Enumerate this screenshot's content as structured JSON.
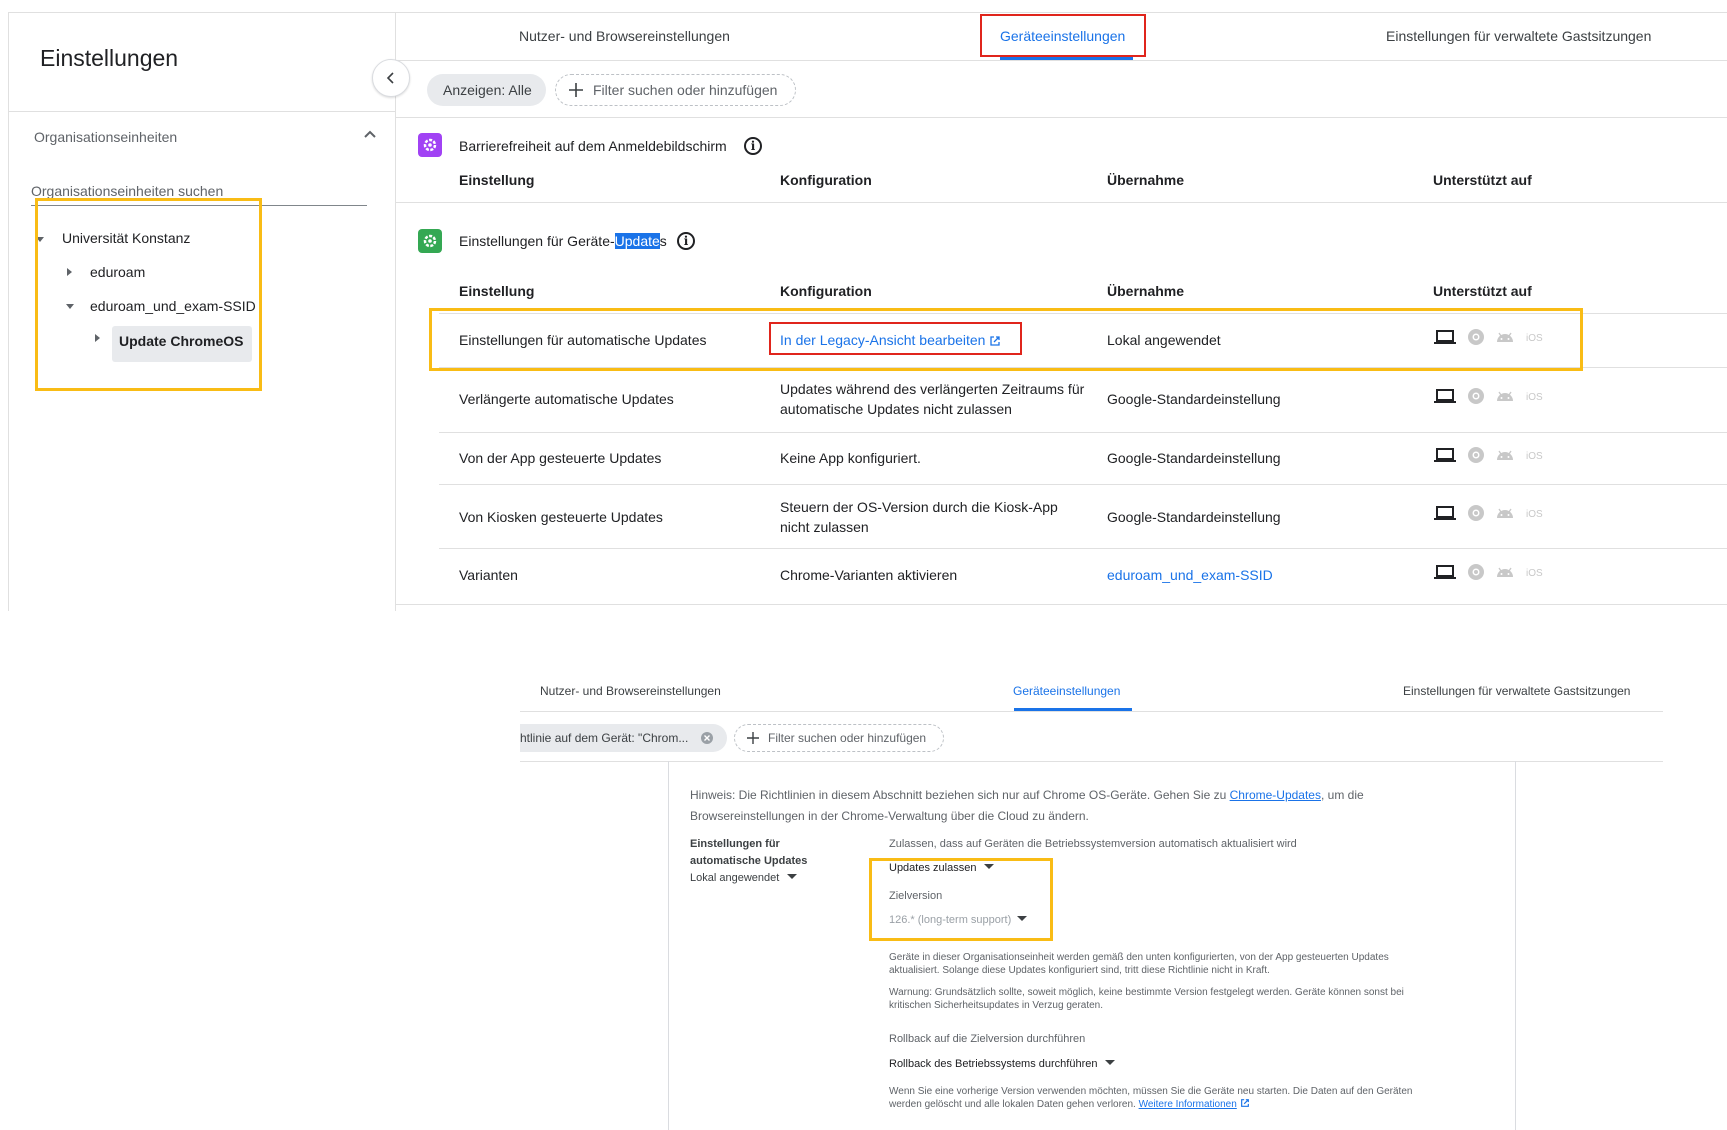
{
  "top": {
    "sidebar": {
      "title": "Einstellungen",
      "ou_header": "Organisationseinheiten",
      "ou_search_placeholder": "Organisationseinheiten suchen",
      "tree": [
        {
          "label": "Universität Konstanz"
        },
        {
          "label": "eduroam"
        },
        {
          "label": "eduroam_und_exam-SSID"
        },
        {
          "label": "Update ChromeOS"
        }
      ]
    },
    "tabs": [
      "Nutzer- und Browsereinstellungen",
      "Geräteeinstellungen",
      "Einstellungen für verwaltete Gastsitzungen"
    ],
    "chip_show": "Anzeigen: Alle",
    "chip_filter": "Filter suchen oder hinzufügen",
    "section1": {
      "title": "Barrierefreiheit auf dem Anmeldebildschirm"
    },
    "section2": {
      "title_before": "Einstellungen für Geräte-",
      "title_highlight": "Update",
      "title_after": "s"
    },
    "columns": [
      "Einstellung",
      "Konfiguration",
      "Übernahme",
      "Unterstützt auf"
    ],
    "rows": [
      {
        "setting": "Einstellungen für automatische Updates",
        "config": "In der Legacy-Ansicht bearbeiten",
        "inherit": "Lokal angewendet"
      },
      {
        "setting": "Verlängerte automatische Updates",
        "config": "Updates während des verlängerten Zeitraums für automatische Updates nicht zulassen",
        "inherit": "Google-Standardeinstellung"
      },
      {
        "setting": "Von der App gesteuerte Updates",
        "config": "Keine App konfiguriert.",
        "inherit": "Google-Standardeinstellung"
      },
      {
        "setting": "Von Kiosken gesteuerte Updates",
        "config": "Steuern der OS-Version durch die Kiosk-App nicht zulassen",
        "inherit": "Google-Standardeinstellung"
      },
      {
        "setting": "Varianten",
        "config": "Chrome-Varianten aktivieren",
        "inherit": "eduroam_und_exam-SSID"
      }
    ],
    "ios_label": "iOS"
  },
  "bottom": {
    "tabs": [
      "Nutzer- und Browsereinstellungen",
      "Geräteeinstellungen",
      "Einstellungen für verwaltete Gastsitzungen"
    ],
    "chip_policy": "htlinie auf dem Gerät: \"Chrom...",
    "chip_filter": "Filter suchen oder hinzufügen",
    "note_before": "Hinweis: Die Richtlinien in diesem Abschnitt beziehen sich nur auf Chrome OS-Geräte. Gehen Sie zu ",
    "note_link": "Chrome-Updates",
    "note_after": ", um die",
    "note_line2": "Browsereinstellungen in der Chrome-Verwaltung über die Cloud zu ändern.",
    "setting_title_1": "Einstellungen für",
    "setting_title_2": "automatische Updates",
    "setting_inherit": "Lokal angewendet",
    "allow_label": "Zulassen, dass auf Geräten die Betriebssystemversion automatisch aktualisiert wird",
    "allow_value": "Updates zulassen",
    "target_label": "Zielversion",
    "target_value": "126.* (long-term support)",
    "info1_line1": "Geräte in dieser Organisationseinheit werden gemäß den unten konfigurierten, von der App gesteuerten Updates",
    "info1_line2": "aktualisiert. Solange diese Updates konfiguriert sind, tritt diese Richtlinie nicht in Kraft.",
    "info2_line1": "Warnung: Grundsätzlich sollte, soweit möglich, keine bestimmte Version festgelegt werden. Geräte können sonst bei",
    "info2_line2": "kritischen Sicherheitsupdates in Verzug geraten.",
    "rollback_label": "Rollback auf die Zielversion durchführen",
    "rollback_value": "Rollback des Betriebssystems durchführen",
    "info3_line1": "Wenn Sie eine vorherige Version verwenden möchten, müssen Sie die Geräte neu starten. Die Daten auf den Geräten",
    "info3_line2": "werden gelöscht und alle lokalen Daten gehen verloren. ",
    "info3_link": "Weitere Informationen"
  },
  "colors": {
    "accent": "#1a73e8",
    "highlight_yellow": "#f9bc15",
    "highlight_red": "#e0251c",
    "section1_icon": "#a142f4",
    "section2_icon": "#34a853"
  }
}
